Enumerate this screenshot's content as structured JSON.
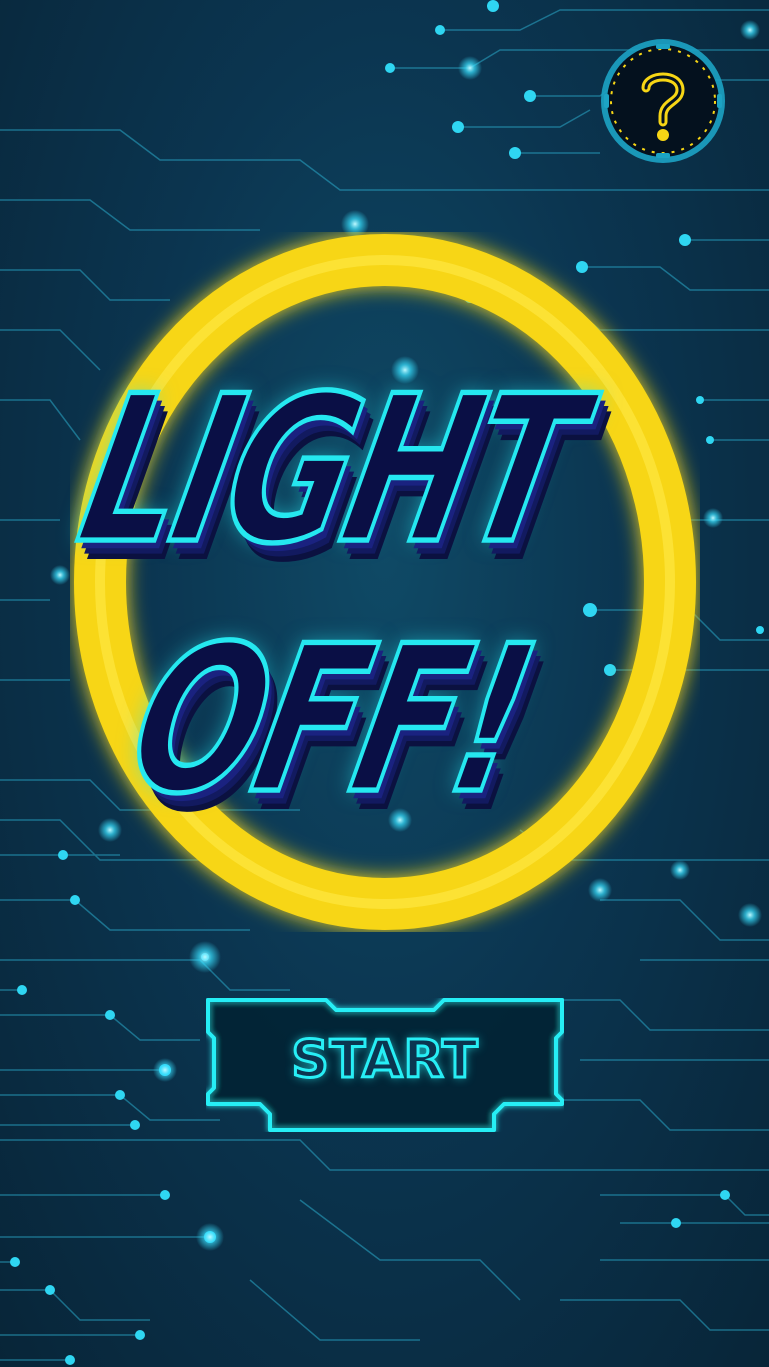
{
  "title": {
    "line1": "LIGHT",
    "line2": "OFF!"
  },
  "buttons": {
    "start_label": "START",
    "help_icon": "question-mark-icon"
  },
  "colors": {
    "background": "#0b3550",
    "neon_cyan": "#25e8f0",
    "ring_yellow": "#f7d615",
    "title_fill": "#0a0f45"
  }
}
